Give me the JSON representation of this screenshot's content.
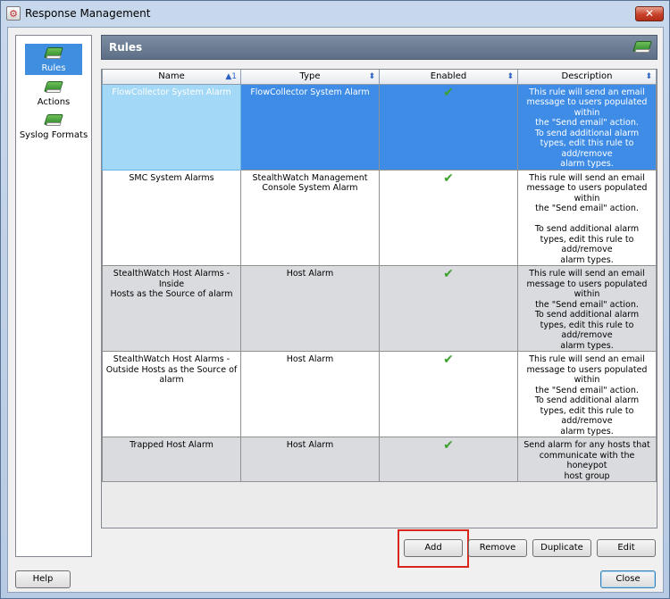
{
  "window": {
    "title": "Response Management",
    "close_glyph": "✕"
  },
  "nav": {
    "items": [
      {
        "label": "Rules",
        "icon": "green-book-icon",
        "selected": true
      },
      {
        "label": "Actions",
        "icon": "green-book-icon",
        "selected": false
      },
      {
        "label": "Syslog Formats",
        "icon": "green-book-icon",
        "selected": false
      }
    ]
  },
  "panel": {
    "title": "Rules",
    "icon": "green-book-icon"
  },
  "table": {
    "columns": [
      {
        "label": "Name",
        "sort": "▲1"
      },
      {
        "label": "Type",
        "sort": "⬍"
      },
      {
        "label": "Enabled",
        "sort": "⬍"
      },
      {
        "label": "Description",
        "sort": "⬍"
      }
    ],
    "rows": [
      {
        "name": "FlowCollector System Alarm",
        "type": "FlowCollector System Alarm",
        "enabled": "✔",
        "description": "This rule will send an email\nmessage to users populated within\nthe \"Send email\" action.\n To send additional alarm\ntypes, edit this rule to add/remove\nalarm types."
      },
      {
        "name": "SMC System Alarms",
        "type": "StealthWatch Management\nConsole System Alarm",
        "enabled": "✔",
        "description": "This rule will send an email\nmessage to users populated within\nthe \"Send email\" action.\n\n To send additional alarm\ntypes, edit this rule to add/remove\nalarm types."
      },
      {
        "name": "StealthWatch Host Alarms - Inside\nHosts as the Source of alarm",
        "type": "Host Alarm",
        "enabled": "✔",
        "description": "This rule will send an email\nmessage to users populated within\nthe \"Send email\" action.\n To send additional alarm\ntypes, edit this rule to add/remove\nalarm types."
      },
      {
        "name": "StealthWatch Host Alarms -\nOutside Hosts as the Source of\nalarm",
        "type": "Host Alarm",
        "enabled": "✔",
        "description": "This rule will send an email\nmessage to users populated within\nthe \"Send email\" action.\n To send additional alarm\ntypes, edit this rule to add/remove\nalarm types."
      },
      {
        "name": "Trapped Host Alarm",
        "type": "Host Alarm",
        "enabled": "✔",
        "description": "Send alarm for any hosts that\ncommunicate with the honeypot\nhost group"
      }
    ]
  },
  "buttons": {
    "add": "Add",
    "remove": "Remove",
    "duplicate": "Duplicate",
    "edit": "Edit",
    "help": "Help",
    "close": "Close"
  },
  "colors": {
    "selection": "#3e8ce6",
    "header_bar": "#6b7c93",
    "check": "#3da12e",
    "highlight": "#d9261c"
  }
}
